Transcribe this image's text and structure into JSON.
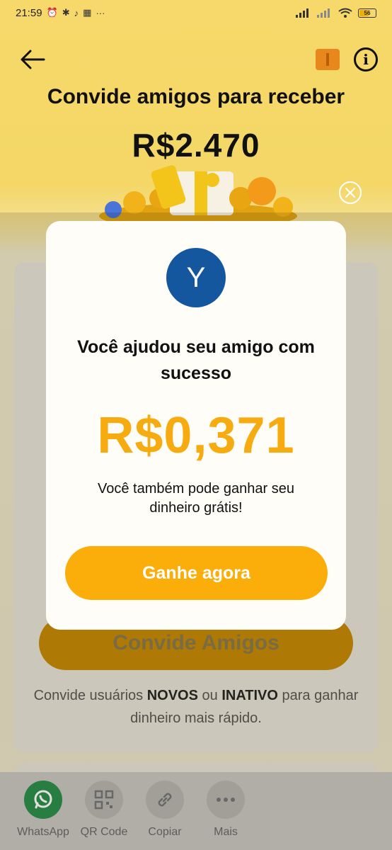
{
  "status_bar": {
    "time": "21:59",
    "icons": [
      "alarm-icon",
      "app-icon",
      "tiktok-icon",
      "qr-icon",
      "more-icon"
    ],
    "battery": "56"
  },
  "header": {
    "title": "Convide amigos para receber",
    "amount": "R$2.470"
  },
  "invite": {
    "button_label": "Convide Amigos",
    "desc_prefix": "Convide usuários ",
    "desc_new": "NOVOS",
    "desc_or": " ou ",
    "desc_inactive": "INATIVO",
    "desc_suffix": " para ganhar dinheiro mais rápido."
  },
  "share": [
    {
      "label": "WhatsApp",
      "icon": "whatsapp-icon"
    },
    {
      "label": "QR Code",
      "icon": "qr-code-icon"
    },
    {
      "label": "Copiar",
      "icon": "link-icon"
    },
    {
      "label": "Mais",
      "icon": "more-icon"
    }
  ],
  "modal": {
    "avatar_initial": "Y",
    "title": "Você ajudou seu amigo com sucesso",
    "amount": "R$0,371",
    "subtitle": "Você também pode ganhar seu dinheiro grátis!",
    "cta_label": "Ganhe agora"
  },
  "colors": {
    "accent": "#fbad0a",
    "amount": "#f6ac10",
    "avatar": "#14579e",
    "whatsapp": "#2e8f4a"
  }
}
